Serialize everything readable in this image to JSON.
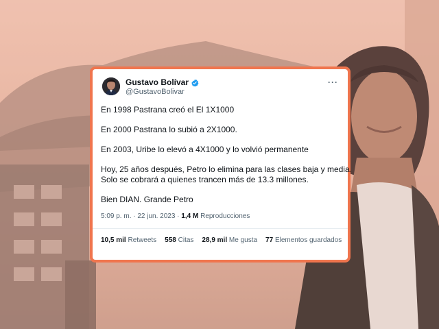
{
  "tweet": {
    "author_name": "Gustavo Bolívar",
    "author_handle": "@GustavoBolivar",
    "more_label": "···",
    "lines": [
      "En 1998 Pastrana creó el El 1X1000",
      "En 2000 Pastrana lo subió a 2X1000.",
      "En 2003, Uribe lo elevó a 4X1000 y lo volvió permanente",
      "Hoy, 25 años después, Petro lo elimina para las clases baja y media.",
      "Solo se cobrará a quienes trancen más de 13.3 millones.",
      "Bien DIAN. Grande Petro"
    ],
    "timestamp": "5:09 p. m. · 22 jun. 2023 · ",
    "views_count": "1,4 M",
    "views_label": " Reproducciones",
    "stats": {
      "retweets_count": "10,5 mil",
      "retweets_label": " Retweets",
      "quotes_count": "558",
      "quotes_label": " Citas",
      "likes_count": "28,9 mil",
      "likes_label": " Me gusta",
      "bookmarks_count": "77",
      "bookmarks_label": " Elementos guardados"
    }
  },
  "colors": {
    "card_border": "#f0754e",
    "verified_blue": "#1d9bf0",
    "background_tint": "#e9b8a4"
  },
  "icons": {
    "verified": "verified-badge-icon",
    "more": "more-options-icon"
  }
}
